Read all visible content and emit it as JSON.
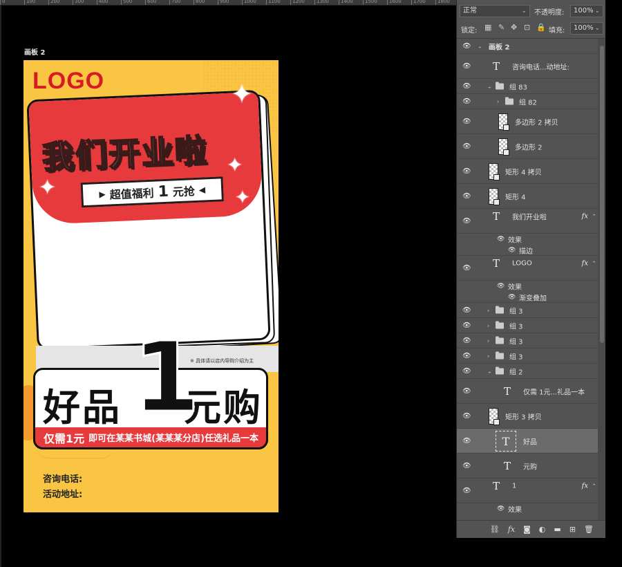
{
  "ruler": {
    "ticks": [
      "0",
      "100",
      "200",
      "300",
      "400",
      "500",
      "600",
      "700",
      "800",
      "900",
      "1000",
      "1100",
      "1200",
      "1300",
      "1400",
      "1500",
      "1600",
      "1700",
      "1800",
      "1900",
      "2000"
    ]
  },
  "artboard": {
    "label": "画板 2",
    "logo": "LOGO",
    "headline": "我们开业啦",
    "subbanner": {
      "part1": "超值福利",
      "big": "1",
      "part2": "元抢"
    },
    "note": "※ 具体请以店内导购介绍为主",
    "goods": "好品",
    "one": "1",
    "buy": "元购",
    "offer_lead": "仅需1元",
    "offer_rest": "即可在某某书城(某某某分店)任选礼品一本",
    "phone": "咨询电话:",
    "address": "活动地址:"
  },
  "panel": {
    "blend_mode": "正常",
    "opacity_label": "不透明度:",
    "opacity_value": "100%",
    "lock_label": "锁定:",
    "fill_label": "填充:",
    "fill_value": "100%",
    "layers": [
      {
        "name": "画板 2",
        "kind": "artboard"
      },
      {
        "name": "咨询电话...动地址:",
        "kind": "text"
      },
      {
        "name": "组 83",
        "kind": "group-open"
      },
      {
        "name": "组 82",
        "kind": "group"
      },
      {
        "name": "多边形 2 拷贝",
        "kind": "shape"
      },
      {
        "name": "多边形 2",
        "kind": "shape"
      },
      {
        "name": "矩形 4 拷贝",
        "kind": "shape"
      },
      {
        "name": "矩形 4",
        "kind": "shape"
      },
      {
        "name": "我们开业啦",
        "kind": "text-fx",
        "effect": "效果",
        "sub": "描边"
      },
      {
        "name": "LOGO",
        "kind": "text-fx",
        "effect": "效果",
        "sub": "渐变叠加"
      },
      {
        "name": "组 3",
        "kind": "group"
      },
      {
        "name": "组 3",
        "kind": "group"
      },
      {
        "name": "组 3",
        "kind": "group"
      },
      {
        "name": "组 3",
        "kind": "group"
      },
      {
        "name": "组 2",
        "kind": "group-open"
      },
      {
        "name": "仅需 1元...礼品一本",
        "kind": "text"
      },
      {
        "name": "矩形 3 拷贝",
        "kind": "shape"
      },
      {
        "name": "好品",
        "kind": "text-selected"
      },
      {
        "name": "元购",
        "kind": "text"
      },
      {
        "name": "1",
        "kind": "text-fx",
        "effect": "效果"
      }
    ],
    "fx_glyph": "fx"
  }
}
